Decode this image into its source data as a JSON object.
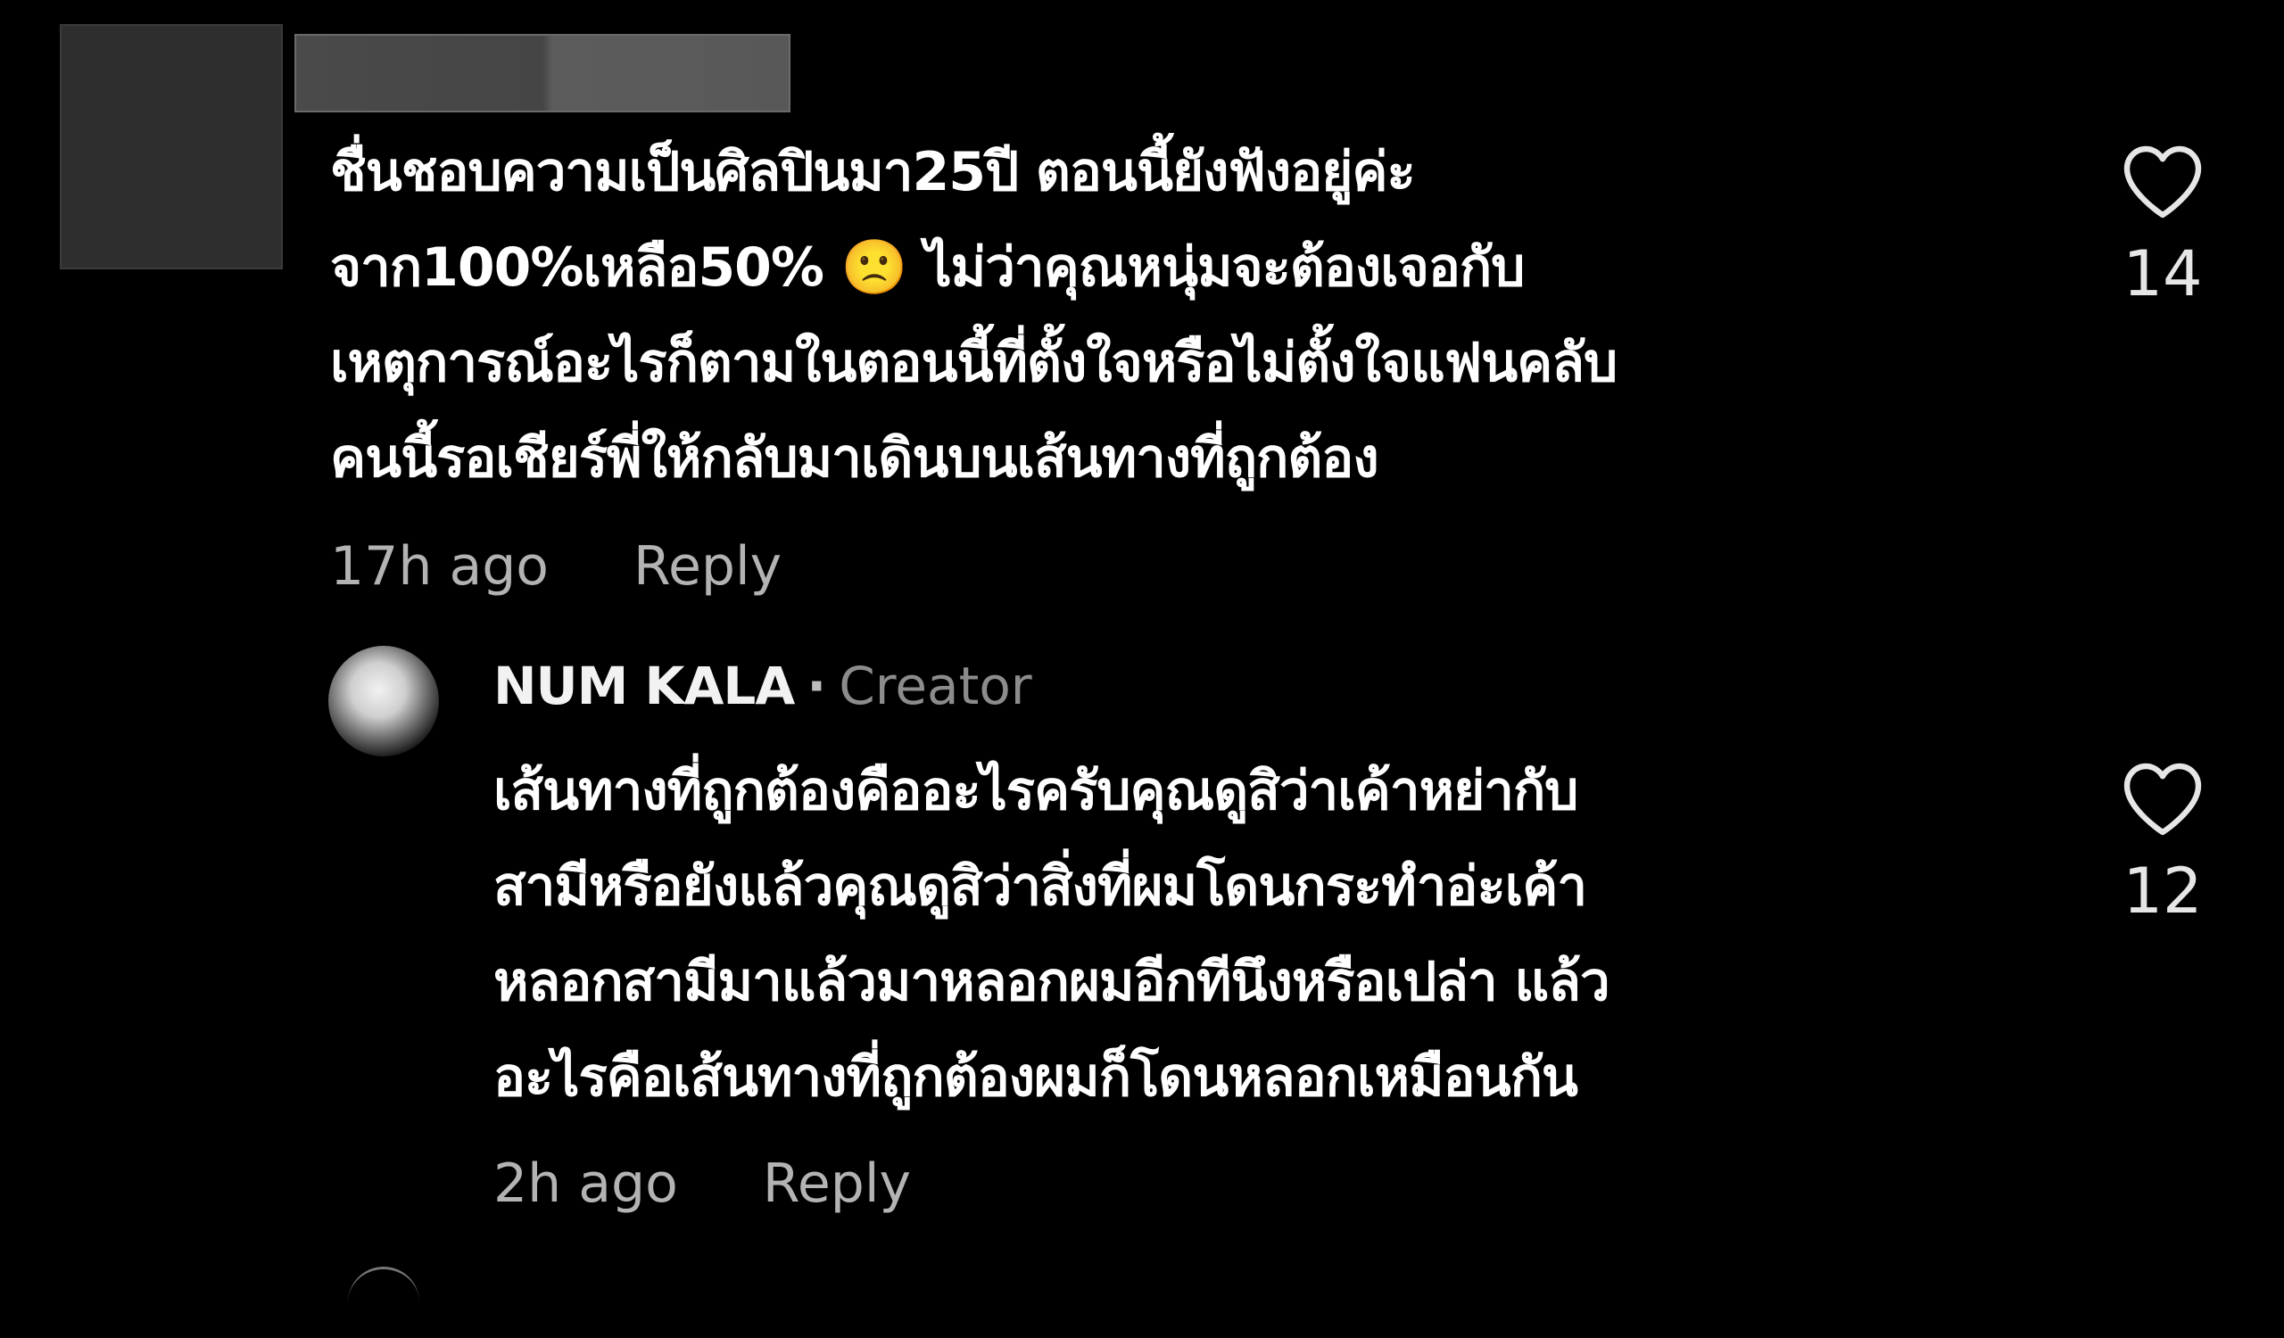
{
  "comment": {
    "text": "ชื่นชอบความเป็นศิลปินมา25ปี ตอนนี้ยังฟังอยู่ค่ะ\nจาก100%เหลือ50% 🙁 ไม่ว่าคุณหนุ่มจะต้องเจอกับ\nเหตุการณ์อะไรก็ตามในตอนนี้ที่ตั้งใจหรือไม่ตั้งใจแฟนคลับ\nคนนี้รอเชียร์พี่ให้กลับมาเดินบนเส้นทางที่ถูกต้อง",
    "time": "17h ago",
    "reply_label": "Reply",
    "like_count": "14",
    "avatar_icon": "redacted-avatar",
    "username_icon": "redacted-username"
  },
  "reply": {
    "author": "NUM KALA",
    "separator": "·",
    "badge": "Creator",
    "text": "เส้นทางที่ถูกต้องคืออะไรครับคุณดูสิว่าเค้าหย่ากับ\nสามีหรือยังแล้วคุณดูสิว่าสิ่งที่ผมโดนกระทำอ่ะเค้า\nหลอกสามีมาแล้วมาหลอกผมอีกทีนึงหรือเปล่า แล้ว\nอะไรคือเส้นทางที่ถูกต้องผมก็โดนหลอกเหมือนกัน",
    "time": "2h ago",
    "reply_label": "Reply",
    "like_count": "12"
  },
  "icons": {
    "like": "heart-outline-icon"
  },
  "colors": {
    "background": "#000000",
    "text_primary": "#ffffff",
    "text_secondary": "#b3b3b3",
    "badge": "#8c8c8c"
  }
}
